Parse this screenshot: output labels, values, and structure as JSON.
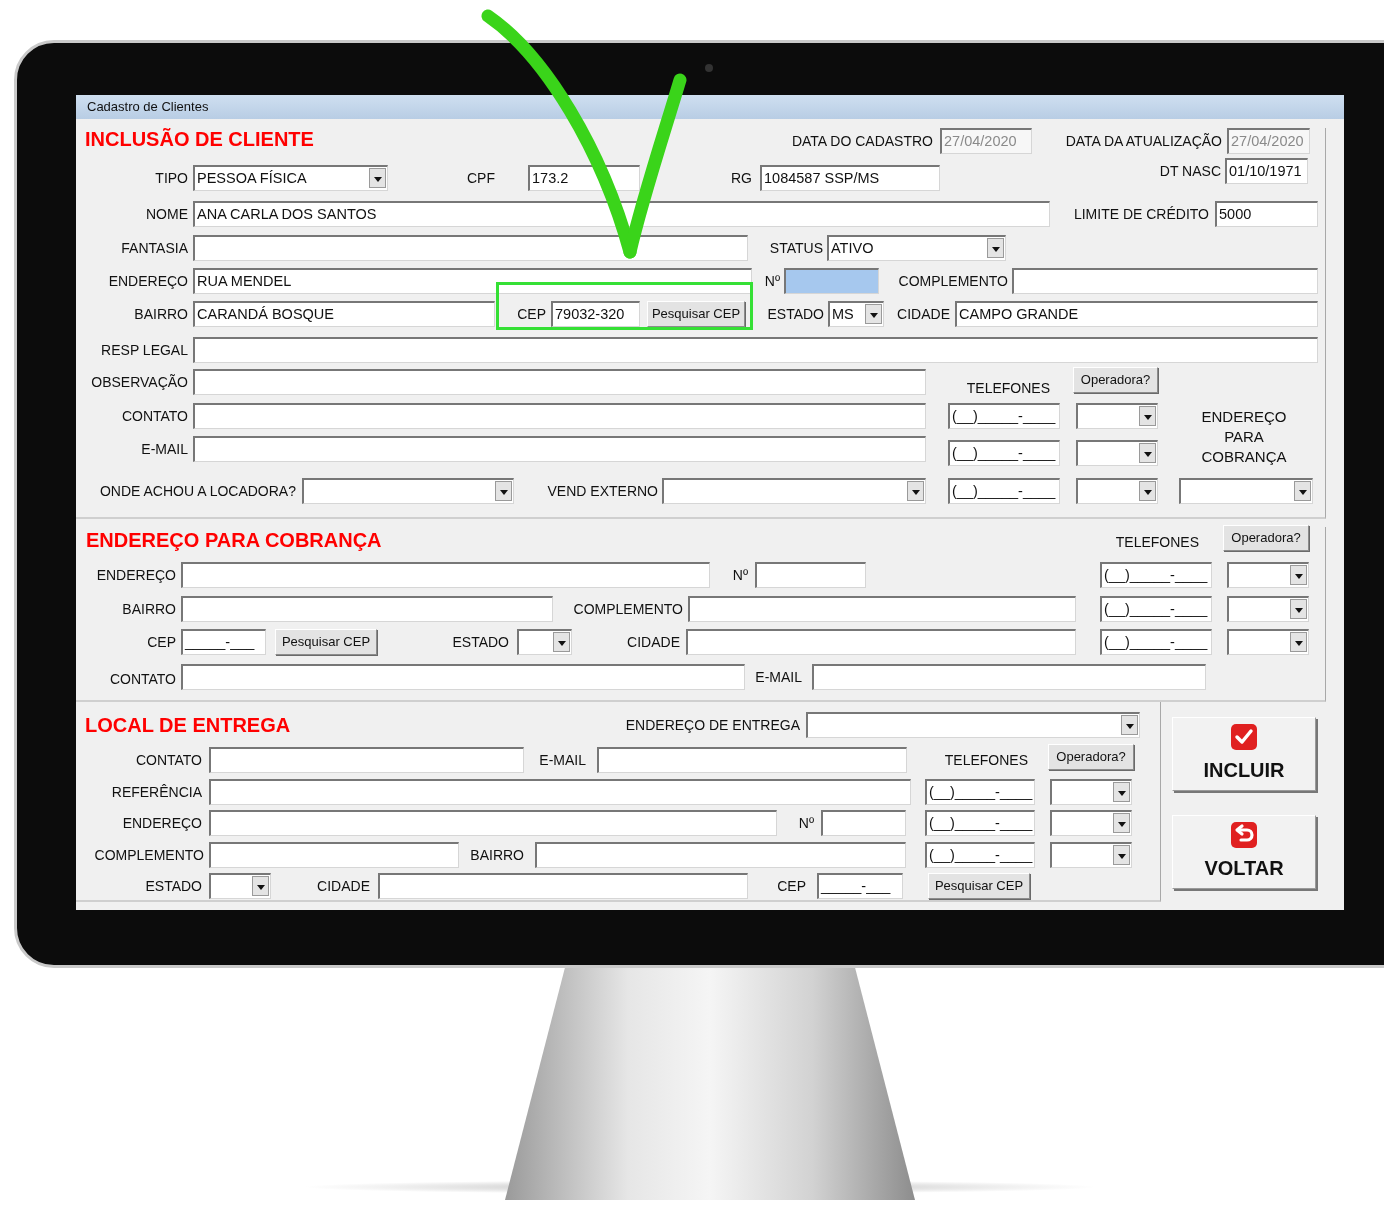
{
  "window": {
    "title": "Cadastro de Clientes"
  },
  "sections": [
    {
      "rows": [
        {
          "items": [
            {
              "kind": "heading",
              "text": "INCLUSÃO DE CLIENTE"
            },
            {
              "kind": "label",
              "text": "DATA DO CADASTRO"
            },
            {
              "kind": "readonly",
              "value": "27/04/2020"
            },
            {
              "kind": "label",
              "text": "DATA DA ATUALIZAÇÃO"
            },
            {
              "kind": "readonly",
              "value": "27/04/2020"
            }
          ]
        },
        {
          "items": [
            {
              "kind": "label",
              "text": "TIPO"
            },
            {
              "kind": "combo",
              "value": "PESSOA FÍSICA"
            },
            {
              "kind": "label",
              "text": "CPF"
            },
            {
              "kind": "field",
              "value": "173.2"
            },
            {
              "kind": "label",
              "text": "RG"
            },
            {
              "kind": "field",
              "value": "1084587 SSP/MS"
            },
            {
              "kind": "label",
              "text": "DT NASC"
            },
            {
              "kind": "field",
              "value": "01/10/1971"
            }
          ]
        },
        {
          "items": [
            {
              "kind": "label",
              "text": "NOME"
            },
            {
              "kind": "field",
              "value": "ANA CARLA DOS SANTOS"
            },
            {
              "kind": "label",
              "text": "LIMITE DE CRÉDITO"
            },
            {
              "kind": "field",
              "value": "5000"
            }
          ]
        },
        {
          "items": [
            {
              "kind": "label",
              "text": "FANTASIA"
            },
            {
              "kind": "field"
            },
            {
              "kind": "label",
              "text": "STATUS"
            },
            {
              "kind": "combo",
              "value": "ATIVO"
            }
          ]
        },
        {
          "items": [
            {
              "kind": "label",
              "text": "ENDEREÇO"
            },
            {
              "kind": "field",
              "value": "RUA MENDEL"
            },
            {
              "kind": "label",
              "text": "Nº"
            },
            {
              "kind": "highlighted"
            },
            {
              "kind": "label",
              "text": "COMPLEMENTO"
            },
            {
              "kind": "field"
            }
          ]
        },
        {
          "items": [
            {
              "kind": "label",
              "text": "BAIRRO"
            },
            {
              "kind": "field",
              "value": "CARANDÁ BOSQUE"
            },
            {
              "kind": "label",
              "text": "CEP"
            },
            {
              "kind": "field",
              "value": "79032-320"
            },
            {
              "kind": "button",
              "text": "Pesquisar CEP"
            },
            {
              "kind": "label",
              "text": "ESTADO"
            },
            {
              "kind": "combo",
              "value": "MS"
            },
            {
              "kind": "label",
              "text": "CIDADE"
            },
            {
              "kind": "field",
              "value": "CAMPO GRANDE"
            }
          ]
        },
        {
          "items": [
            {
              "kind": "label",
              "text": "RESP LEGAL"
            },
            {
              "kind": "field"
            }
          ]
        },
        {
          "items": [
            {
              "kind": "label",
              "text": "OBSERVAÇÃO"
            },
            {
              "kind": "field"
            },
            {
              "kind": "label",
              "text": "TELEFONES"
            },
            {
              "kind": "button",
              "text": "Operadora?"
            }
          ]
        },
        {
          "items": [
            {
              "kind": "label",
              "text": "CONTATO"
            },
            {
              "kind": "field"
            },
            {
              "kind": "field",
              "value": "(__)_____-____"
            },
            {
              "kind": "combo"
            },
            {
              "kind": "caption",
              "text": "ENDEREÇO PARA COBRANÇA"
            }
          ]
        },
        {
          "items": [
            {
              "kind": "label",
              "text": "E-MAIL"
            },
            {
              "kind": "field"
            },
            {
              "kind": "field",
              "value": "(__)_____-____"
            },
            {
              "kind": "combo"
            }
          ]
        },
        {
          "items": [
            {
              "kind": "label",
              "text": "ONDE ACHOU A LOCADORA?"
            },
            {
              "kind": "combo"
            },
            {
              "kind": "label",
              "text": "VEND EXTERNO"
            },
            {
              "kind": "combo"
            },
            {
              "kind": "field",
              "value": "(__)_____-____"
            },
            {
              "kind": "combo"
            },
            {
              "kind": "combo"
            }
          ]
        }
      ]
    },
    {
      "rows": [
        {
          "items": [
            {
              "kind": "heading",
              "text": "ENDEREÇO PARA COBRANÇA"
            },
            {
              "kind": "label",
              "text": "TELEFONES"
            },
            {
              "kind": "button",
              "text": "Operadora?"
            }
          ]
        },
        {
          "items": [
            {
              "kind": "label",
              "text": "ENDEREÇO"
            },
            {
              "kind": "field"
            },
            {
              "kind": "label",
              "text": "Nº"
            },
            {
              "kind": "field"
            },
            {
              "kind": "field",
              "value": "(__)_____-____"
            },
            {
              "kind": "combo"
            }
          ]
        },
        {
          "items": [
            {
              "kind": "label",
              "text": "BAIRRO"
            },
            {
              "kind": "field"
            },
            {
              "kind": "label",
              "text": "COMPLEMENTO"
            },
            {
              "kind": "field"
            },
            {
              "kind": "field",
              "value": "(__)_____-____"
            },
            {
              "kind": "combo"
            }
          ]
        },
        {
          "items": [
            {
              "kind": "label",
              "text": "CEP"
            },
            {
              "kind": "field",
              "value": "_____-___"
            },
            {
              "kind": "button",
              "text": "Pesquisar CEP"
            },
            {
              "kind": "label",
              "text": "ESTADO"
            },
            {
              "kind": "combo"
            },
            {
              "kind": "label",
              "text": "CIDADE"
            },
            {
              "kind": "field"
            },
            {
              "kind": "field",
              "value": "(__)_____-____"
            },
            {
              "kind": "combo"
            }
          ]
        },
        {
          "items": [
            {
              "kind": "label",
              "text": "CONTATO"
            },
            {
              "kind": "field"
            },
            {
              "kind": "label",
              "text": "E-MAIL"
            },
            {
              "kind": "field"
            }
          ]
        }
      ]
    },
    {
      "rows": [
        {
          "items": [
            {
              "kind": "heading",
              "text": "LOCAL DE ENTREGA"
            },
            {
              "kind": "label",
              "text": "ENDEREÇO DE ENTREGA"
            },
            {
              "kind": "combo"
            }
          ]
        },
        {
          "items": [
            {
              "kind": "label",
              "text": "CONTATO"
            },
            {
              "kind": "field"
            },
            {
              "kind": "label",
              "text": "E-MAIL"
            },
            {
              "kind": "field"
            },
            {
              "kind": "label",
              "text": "TELEFONES"
            },
            {
              "kind": "button",
              "text": "Operadora?"
            }
          ]
        },
        {
          "items": [
            {
              "kind": "label",
              "text": "REFERÊNCIA"
            },
            {
              "kind": "field"
            },
            {
              "kind": "field",
              "value": "(__)_____-____"
            },
            {
              "kind": "combo"
            }
          ]
        },
        {
          "items": [
            {
              "kind": "label",
              "text": "ENDEREÇO"
            },
            {
              "kind": "field"
            },
            {
              "kind": "label",
              "text": "Nº"
            },
            {
              "kind": "field"
            },
            {
              "kind": "field",
              "value": "(__)_____-____"
            },
            {
              "kind": "combo"
            }
          ]
        },
        {
          "items": [
            {
              "kind": "label",
              "text": "COMPLEMENTO"
            },
            {
              "kind": "field"
            },
            {
              "kind": "label",
              "text": "BAIRRO"
            },
            {
              "kind": "field"
            },
            {
              "kind": "field",
              "value": "(__)_____-____"
            },
            {
              "kind": "combo"
            }
          ]
        },
        {
          "items": [
            {
              "kind": "label",
              "text": "ESTADO"
            },
            {
              "kind": "combo"
            },
            {
              "kind": "label",
              "text": "CIDADE"
            },
            {
              "kind": "field"
            },
            {
              "kind": "label",
              "text": "CEP"
            },
            {
              "kind": "field",
              "value": "_____-___"
            },
            {
              "kind": "button",
              "text": "Pesquisar CEP"
            }
          ]
        }
      ]
    }
  ],
  "actions": [
    {
      "label": "INCLUIR",
      "kind": "confirm"
    },
    {
      "label": "VOLTAR",
      "kind": "back"
    }
  ]
}
